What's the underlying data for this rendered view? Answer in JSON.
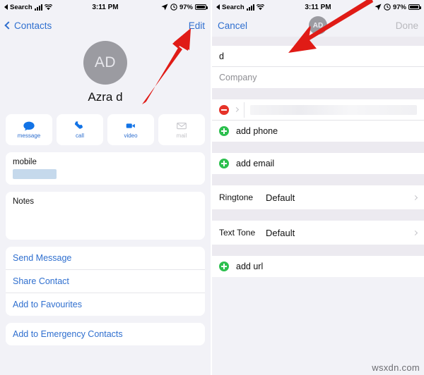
{
  "statusbar": {
    "carrier_back": "back-triangle",
    "carrier": "Search",
    "time": "3:11 PM",
    "battery_percent": "97%",
    "icons": [
      "signal-bars-icon",
      "wifi-icon",
      "location-arrow-icon",
      "alarm-clock-icon",
      "battery-icon"
    ]
  },
  "left_panel": {
    "nav": {
      "back_label": "Contacts",
      "edit_label": "Edit"
    },
    "avatar_initials": "AD",
    "contact_name": "Azra d",
    "actions": [
      {
        "label": "message",
        "icon": "message-bubble-icon",
        "enabled": true
      },
      {
        "label": "call",
        "icon": "phone-handset-icon",
        "enabled": true
      },
      {
        "label": "video",
        "icon": "video-camera-icon",
        "enabled": true
      },
      {
        "label": "mail",
        "icon": "envelope-icon",
        "enabled": false
      }
    ],
    "phone_field": {
      "label": "mobile",
      "value": ""
    },
    "notes_label": "Notes",
    "links": [
      "Send Message",
      "Share Contact",
      "Add to Favourites"
    ],
    "links2": [
      "Add to Emergency Contacts"
    ]
  },
  "right_panel": {
    "nav": {
      "cancel_label": "Cancel",
      "avatar_initials": "AD",
      "done_label": "Done"
    },
    "name_field": {
      "value": "d"
    },
    "company_field": {
      "placeholder": "Company"
    },
    "phone_row": {
      "delete_icon": "minus-circle-icon",
      "value": ""
    },
    "add_phone_label": "add phone",
    "add_email_label": "add email",
    "ringtone": {
      "label": "Ringtone",
      "value": "Default"
    },
    "texttone": {
      "label": "Text Tone",
      "value": "Default"
    },
    "add_url_label": "add url"
  },
  "annotations": {
    "arrow_color": "#e01b16",
    "arrow_left_target": "Edit",
    "arrow_right_target": "Default"
  },
  "watermark": "wsxdn.com"
}
